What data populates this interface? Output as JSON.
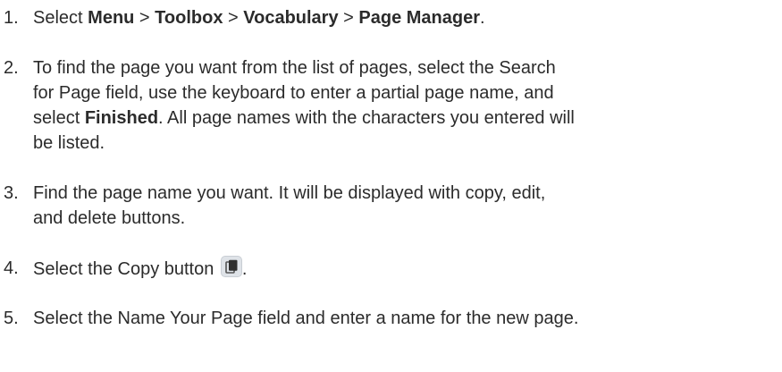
{
  "steps": [
    {
      "number": "1.",
      "parts": [
        {
          "t": "Select "
        },
        {
          "b": "Menu"
        },
        {
          "t": " > "
        },
        {
          "b": "Toolbox"
        },
        {
          "t": " > "
        },
        {
          "b": "Vocabulary"
        },
        {
          "t": " > "
        },
        {
          "b": "Page Manager"
        },
        {
          "t": "."
        }
      ]
    },
    {
      "number": "2.",
      "line1": "To find the page you want from the list of pages, select the Search",
      "line2": "for Page field, use the keyboard to enter a partial page name, and",
      "line3_pre": "select ",
      "line3_bold": "Finished",
      "line3_post": ". All page names with the characters you entered will",
      "line4": "be listed."
    },
    {
      "number": "3.",
      "line1": "Find the page name you want. It will be displayed with copy, edit,",
      "line2": "and delete buttons."
    },
    {
      "number": "4.",
      "text_pre": "Select the Copy button ",
      "text_post": ".",
      "icon": "copy-icon"
    },
    {
      "number": "5.",
      "text": "Select the Name Your Page field and enter a name for the new page."
    }
  ]
}
